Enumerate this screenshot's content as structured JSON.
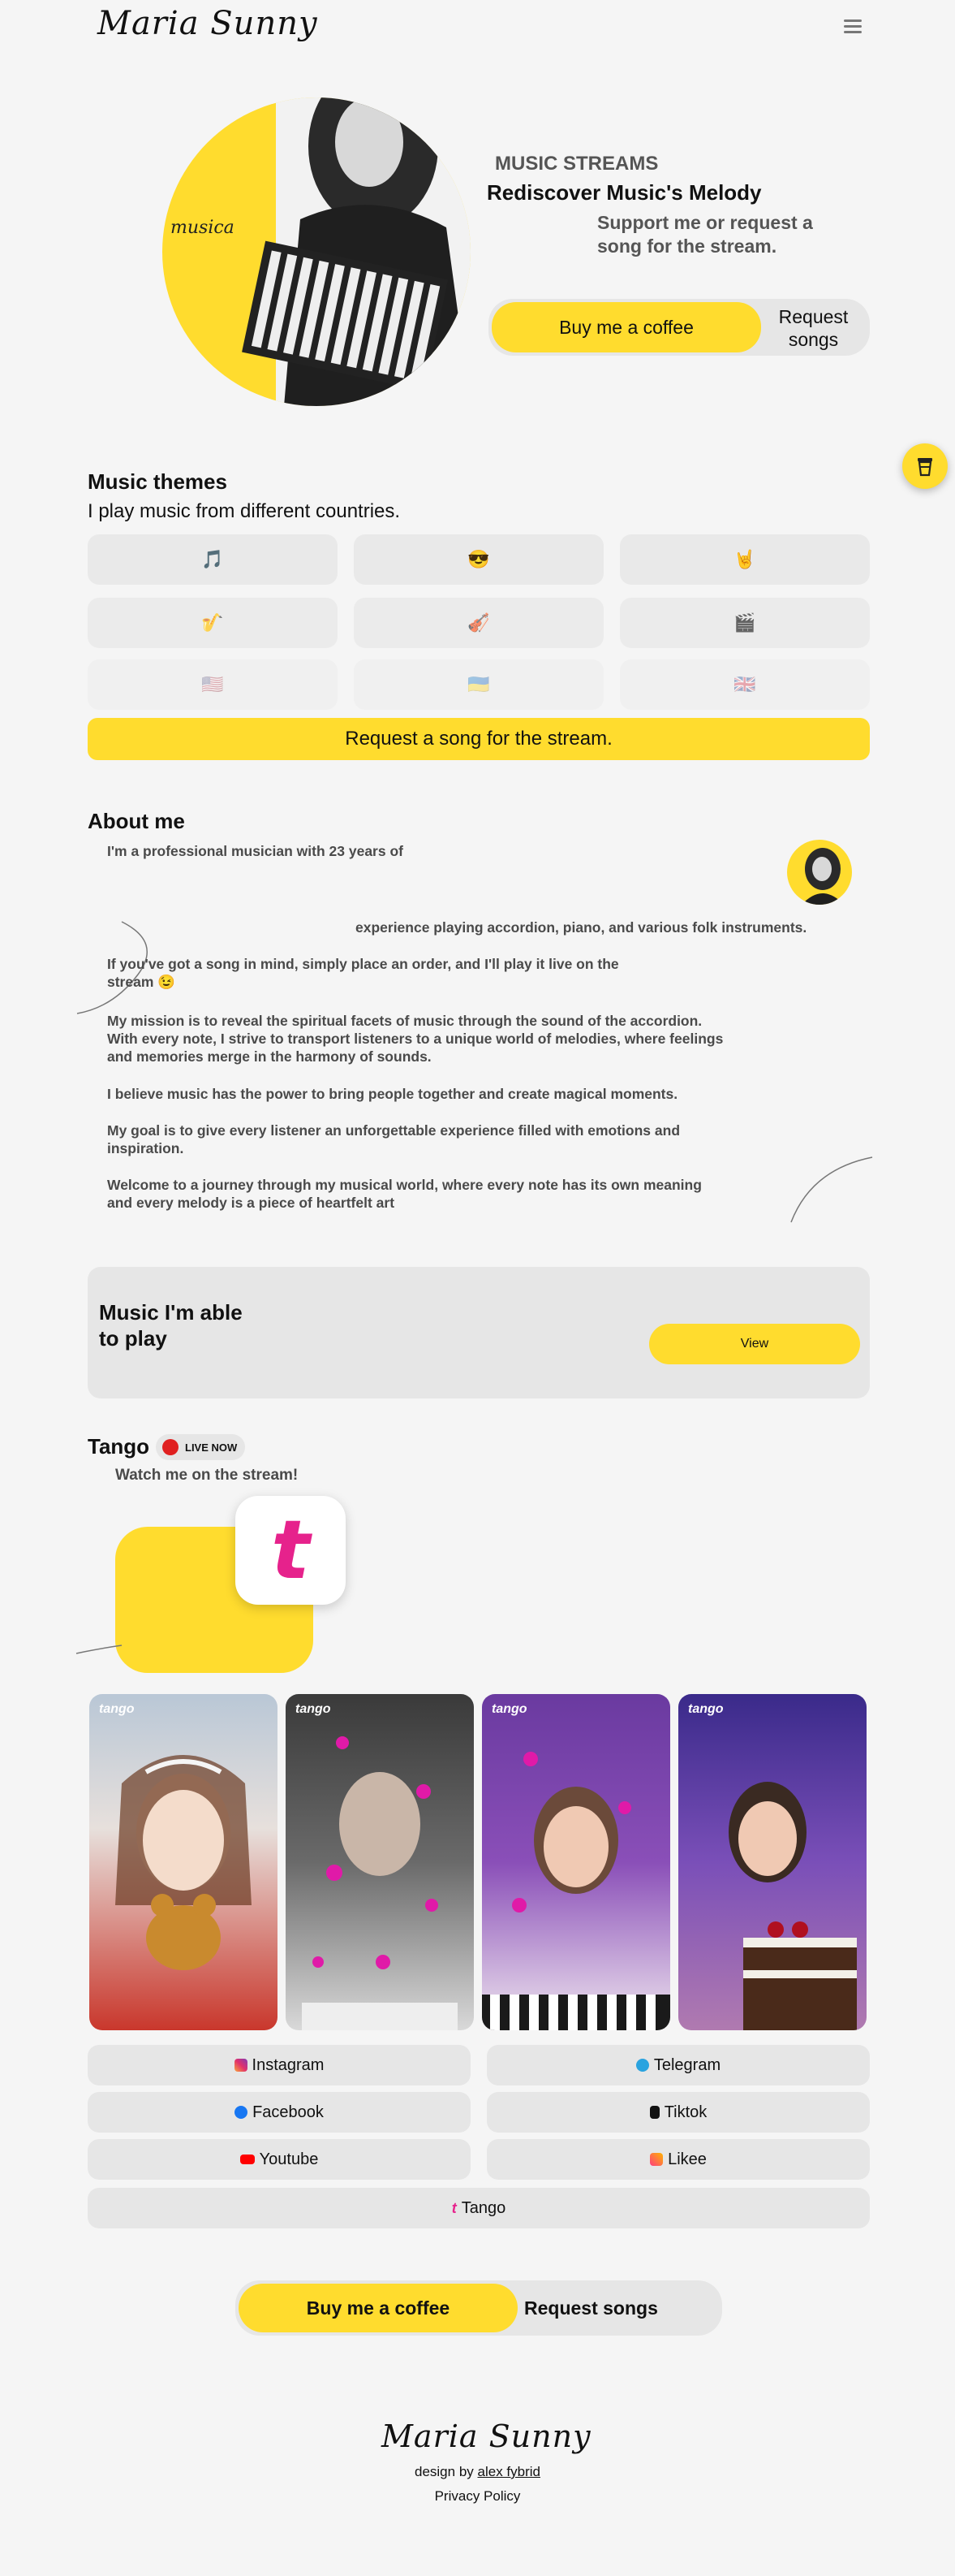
{
  "header": {
    "logo_text": "Maria Sunny",
    "menu_icon": "hamburger-icon"
  },
  "hero": {
    "photo_caption": "musica",
    "kicker": "MUSIC STREAMS",
    "title": "Rediscover Music's Melody",
    "subtitle": "Support me or request a song for the stream.",
    "buy_label": "Buy me a coffee",
    "request_label": "Request songs"
  },
  "floating": {
    "icon": "coffee-cup-icon"
  },
  "themes": {
    "title": "Music themes",
    "subtitle": "I play music from different countries.",
    "tiles": [
      "🎵",
      "😎",
      "🤘",
      "🎷",
      "🎻",
      "🎬",
      "🇺🇸",
      "🇺🇦",
      "🇬🇧"
    ],
    "request_label": "Request a song for the stream."
  },
  "about": {
    "title": "About me",
    "p1a": "I'm a professional musician with 23 years of",
    "p1b": "experience playing accordion, piano, and various folk instruments.",
    "p2": "If you've got a song in mind, simply place an order, and I'll play it live on the stream 😉",
    "p3": "My mission is to reveal the spiritual facets of music through the sound of the accordion. With every note, I strive to transport listeners to a unique world of melodies, where feelings and memories merge in the harmony of sounds.",
    "p4": "I believe music has the power to bring people together and create magical moments.",
    "p5": "My goal is to give every listener an unforgettable experience filled with emotions and inspiration.",
    "p6": "Welcome to a journey through my musical world, where every note has its own meaning and every melody is a piece of heartfelt art"
  },
  "music_card": {
    "title": "Music I'm able to play",
    "view_label": "View"
  },
  "tango": {
    "title": "Tango",
    "live_label": "LIVE NOW",
    "subtitle": "Watch me on the stream!",
    "app_letter": "t",
    "thumb_brand": "tango"
  },
  "socials": {
    "instagram": "Instagram",
    "telegram": "Telegram",
    "facebook": "Facebook",
    "tiktok": "Tiktok",
    "youtube": "Youtube",
    "likee": "Likee",
    "tango": "Tango"
  },
  "bottom_cta": {
    "buy_label": "Buy me a coffee",
    "request_label": "Request songs"
  },
  "footer": {
    "logo_text": "Maria Sunny",
    "design_by": "design by",
    "designer": "alex fybrid",
    "privacy": "Privacy Policy"
  },
  "colors": {
    "accent": "#ffdc2e",
    "background": "#f5f5f5",
    "tile": "#e9e9e9",
    "tango_pink": "#e6228c",
    "live_red": "#e02020"
  }
}
